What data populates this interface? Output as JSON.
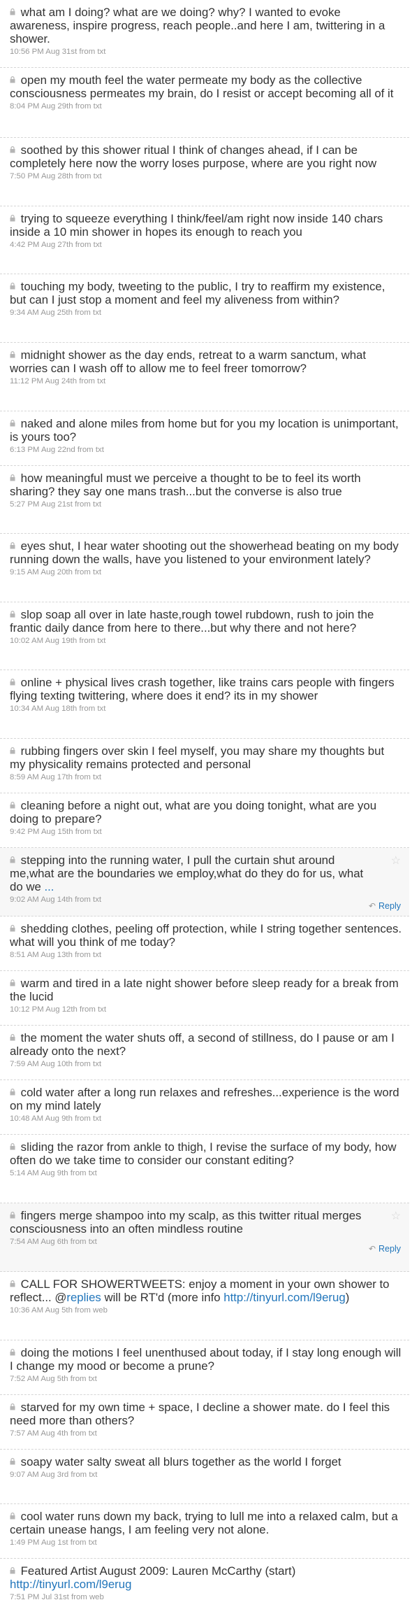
{
  "tweets": [
    {
      "text": "what am I doing? what are we doing? why? I wanted to evoke awareness, inspire progress, reach people..and here I am, twittering in a shower.",
      "meta": "10:56 PM Aug 31st from txt"
    },
    {
      "text": "open my mouth feel the water permeate my body as the collective consciousness permeates my brain, do I resist or accept becoming all of it",
      "meta": "8:04 PM Aug 29th from txt"
    },
    {
      "text": "soothed by this shower ritual I think of changes ahead, if I can be completely here now the worry loses purpose, where are you right now",
      "meta": "7:50 PM Aug 28th from txt"
    },
    {
      "text": "trying to squeeze everything I think/feel/am right now inside 140 chars inside a 10 min shower in hopes its enough to reach you",
      "meta": "4:42 PM Aug 27th from txt"
    },
    {
      "text": "touching my body, tweeting to the public, I try to reaffirm my existence, but can I just stop a moment and feel my aliveness from within?",
      "meta": "9:34 AM Aug 25th from txt"
    },
    {
      "text": "midnight shower as the day ends, retreat to a warm sanctum, what worries can I wash off to allow me to feel freer tomorrow?",
      "meta": "11:12 PM Aug 24th from txt"
    },
    {
      "text": "naked and alone miles from home but for you my location is unimportant, is yours too?",
      "meta": "6:13 PM Aug 22nd from txt"
    },
    {
      "text": "how meaningful must we perceive a thought to be to feel its worth sharing? they say one mans trash...but the converse is also true",
      "meta": "5:27 PM Aug 21st from txt"
    },
    {
      "text": "eyes shut, I hear water shooting out the showerhead beating on my body running down the walls, have you listened to your environment lately?",
      "meta": "9:15 AM Aug 20th from txt"
    },
    {
      "text": "slop soap all over in late haste,rough towel rubdown, rush to join the frantic daily dance from here to there...but why there and not here?",
      "meta": "10:02 AM Aug 19th from txt"
    },
    {
      "text": "online + physical lives crash together, like trains cars people with fingers flying texting twittering, where does it end? its in my shower",
      "meta": "10:34 AM Aug 18th from txt"
    },
    {
      "text": "rubbing fingers over skin I feel myself, you may share my thoughts but my physicality remains protected and personal",
      "meta": "8:59 AM Aug 17th from txt"
    },
    {
      "text": "cleaning before a night out, what are you doing tonight, what are you doing to prepare?",
      "meta": "9:42 PM Aug 15th from txt"
    },
    {
      "text": "stepping into the running water, I pull the curtain shut around me,what are the boundaries we employ,what do they do for us, what do we",
      "more": "...",
      "meta": "9:02 AM Aug 14th from txt",
      "reply": "Reply"
    },
    {
      "text": "shedding clothes, peeling off protection, while I string together sentences. what will you think of me today?",
      "meta": "8:51 AM Aug 13th from txt"
    },
    {
      "text": "warm and tired in a late night shower before sleep ready for a break from the lucid",
      "meta": "10:12 PM Aug 12th from txt"
    },
    {
      "text": "the moment the water shuts off, a second of stillness, do I pause or am I already onto the next?",
      "meta": "7:59 AM Aug 10th from txt"
    },
    {
      "text": "cold water after a long run relaxes and refreshes...experience is the word on my mind lately",
      "meta": "10:48 AM Aug 9th from txt"
    },
    {
      "text": "sliding the razor from ankle to thigh, I revise the surface of my body, how often do we take time to consider our constant editing?",
      "meta": "5:14 AM Aug 9th from txt"
    },
    {
      "text": "fingers merge shampoo into my scalp, as this twitter ritual merges consciousness into an often mindless routine",
      "meta": "7:54 AM Aug 6th from txt",
      "reply": "Reply"
    },
    {
      "text_a": "CALL FOR SHOWERTWEETS: enjoy a moment in your own shower to reflect... @",
      "link_a": "replies",
      "text_b": " will be RT'd (more info ",
      "link_b": "http://tinyurl.com/l9erug",
      "text_c": ")",
      "meta": "10:36 AM Aug 5th from web"
    },
    {
      "text": "doing the motions I feel unenthused about today, if I stay long enough will I change my mood or become a prune?",
      "meta": "7:52 AM Aug 5th from txt"
    },
    {
      "text": "starved for my own time + space, I decline a shower mate. do I feel this need more than others?",
      "meta": "7:57 AM Aug 4th from txt"
    },
    {
      "text": "soapy water salty sweat all blurs together as the world I forget",
      "meta": "9:07 AM Aug 3rd from txt"
    },
    {
      "text": "cool water runs down my back, trying to lull me into a relaxed calm, but a certain unease hangs, I am feeling very not alone.",
      "meta": "1:49 PM Aug 1st from txt"
    },
    {
      "text": "Featured Artist August 2009: Lauren McCarthy (start)",
      "link_b": "http://tinyurl.com/l9erug",
      "meta": "7:51 PM Jul 31st from web"
    }
  ],
  "colors": {
    "text": "#333333",
    "meta": "#999999",
    "link": "#2276bb",
    "divider": "#d6d6d6",
    "highlight": "#f7f7f7"
  },
  "icons": {
    "lock": "lock-icon",
    "star": "star-icon",
    "reply": "reply-arrow-icon"
  }
}
